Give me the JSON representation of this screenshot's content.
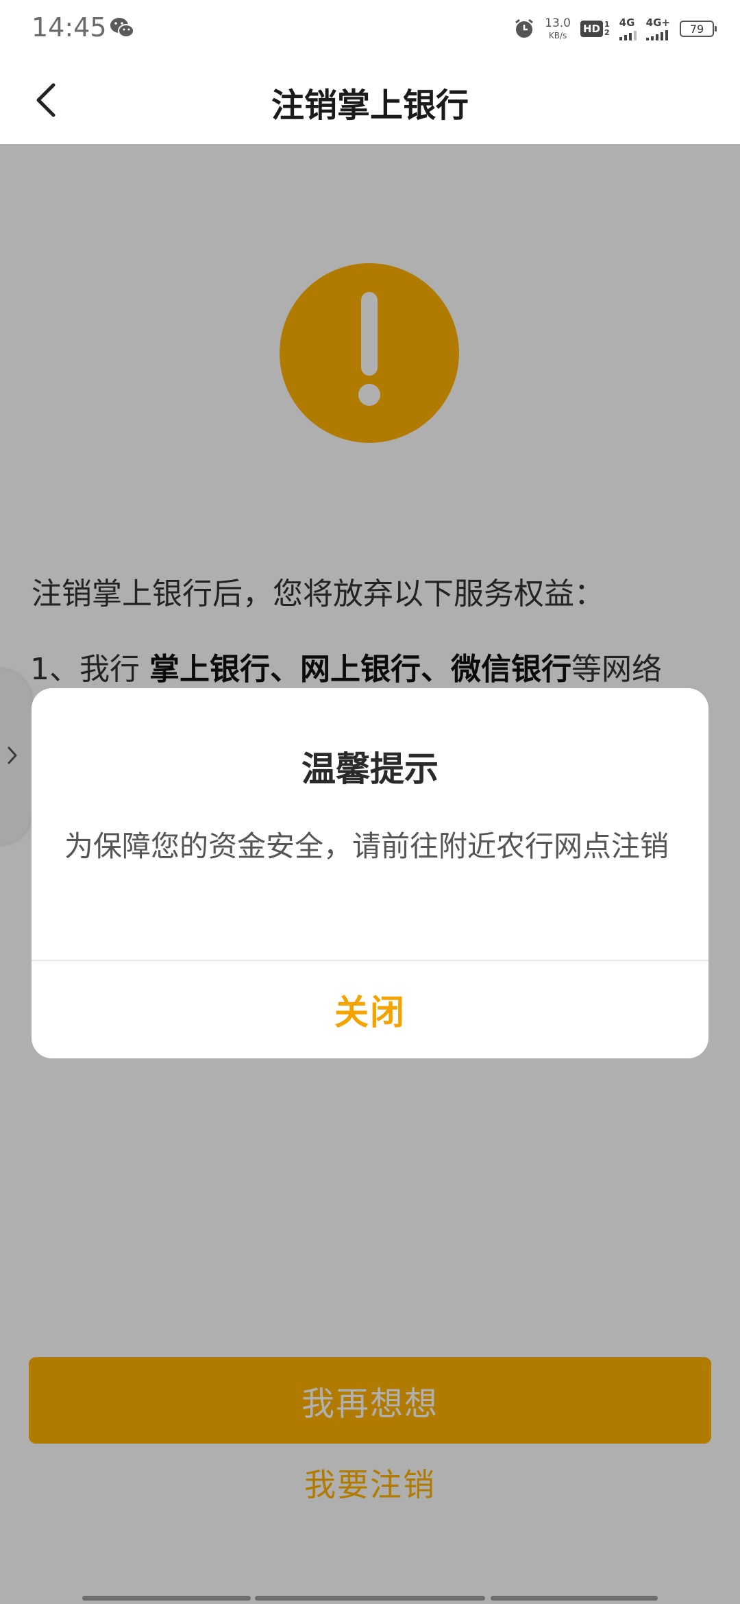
{
  "status_bar": {
    "time": "14:45",
    "net_speed_value": "13.0",
    "net_speed_unit": "KB/s",
    "hd_label": "HD",
    "hd_sim_top": "1",
    "hd_sim_bottom": "2",
    "sim1_label": "4G",
    "sim2_label": "4G+",
    "battery_level": "79"
  },
  "nav": {
    "title": "注销掌上银行",
    "back_icon": "chevron-left-icon"
  },
  "content": {
    "warning_icon": "exclamation-circle-icon",
    "intro": "注销掌上银行后，您将放弃以下服务权益：",
    "item_1": {
      "prefix": "1、我行 ",
      "highlight": "掌上银行、网上银行、微信银行",
      "suffix": "等网络"
    },
    "primary_button": "我再想想",
    "secondary_link": "我要注销"
  },
  "dialog": {
    "title": "温馨提示",
    "message": "为保障您的资金安全，请前往附近农行网点注销",
    "close_button": "关闭"
  },
  "colors": {
    "accent": "#ffb200",
    "dialog_button": "#f5a300",
    "overlay": "rgba(0,0,0,0.31)"
  }
}
